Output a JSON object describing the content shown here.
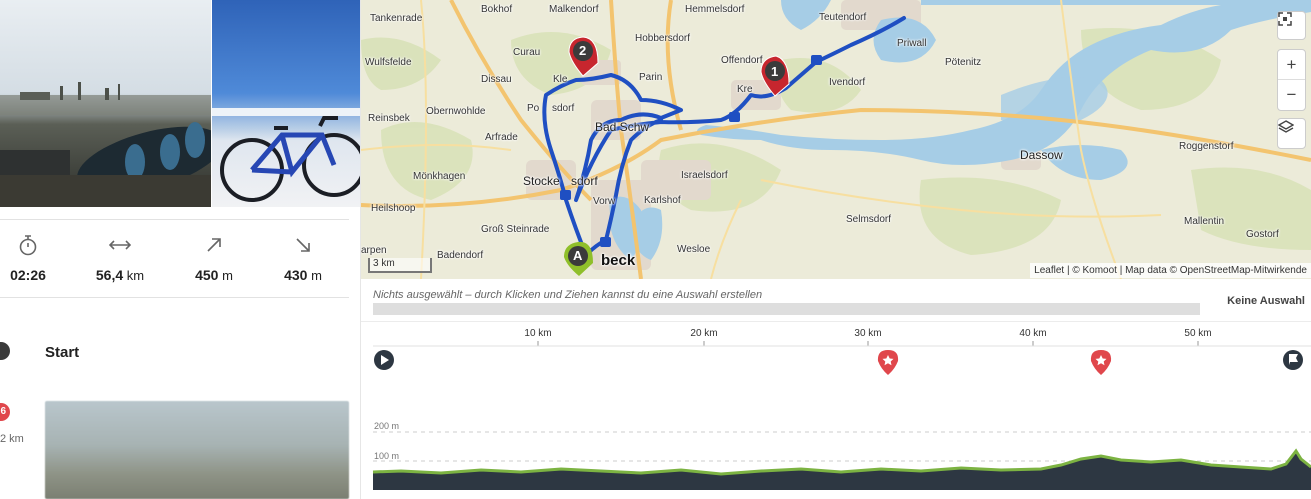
{
  "stats": {
    "duration": {
      "icon": "stopwatch-icon",
      "value": "02:26",
      "unit": ""
    },
    "distance": {
      "icon": "distance-arrows-icon",
      "value": "56,4",
      "unit": " km"
    },
    "uphill": {
      "icon": "arrow-up-right-icon",
      "value": "450",
      "unit": " m"
    },
    "downhill": {
      "icon": "arrow-down-right-icon",
      "value": "430",
      "unit": " m"
    }
  },
  "timeline": {
    "start_label": "Start",
    "highlight_badge": "6",
    "highlight_distance": "2 km"
  },
  "map": {
    "places": [
      {
        "name": "Tankenrade"
      },
      {
        "name": "Bokhof"
      },
      {
        "name": "Malkendorf"
      },
      {
        "name": "Hemmelsdorf"
      },
      {
        "name": "Teutendorf"
      },
      {
        "name": "Priwall"
      },
      {
        "name": "Curau"
      },
      {
        "name": "Hobbersdorf"
      },
      {
        "name": "Wulfsfelde"
      },
      {
        "name": "Dissau"
      },
      {
        "name": "Kle"
      },
      {
        "name": "Parin"
      },
      {
        "name": "Offendorf"
      },
      {
        "name": "Ivendorf"
      },
      {
        "name": "Pötenitz"
      },
      {
        "name": "Obernwohlde"
      },
      {
        "name": "Po"
      },
      {
        "name": "sdorf"
      },
      {
        "name": "Kre"
      },
      {
        "name": "Reinsbek"
      },
      {
        "name": "Arfrade"
      },
      {
        "name": "Bad Schw"
      },
      {
        "name": "Dassow"
      },
      {
        "name": "Roggenstorf"
      },
      {
        "name": "Mönkhagen"
      },
      {
        "name": "Stocke"
      },
      {
        "name": "sdorf"
      },
      {
        "name": "Israelsdorf"
      },
      {
        "name": "Heilshoop"
      },
      {
        "name": "Vorw"
      },
      {
        "name": "Karlshof"
      },
      {
        "name": "Selmsdorf"
      },
      {
        "name": "Mallentin"
      },
      {
        "name": "Groß Steinrade"
      },
      {
        "name": "Gostorf"
      },
      {
        "name": "arpen"
      },
      {
        "name": "Wesloe"
      },
      {
        "name": "Badendorf"
      },
      {
        "name": "beck"
      }
    ],
    "markers": {
      "waypoint1": "1",
      "waypoint2": "2",
      "start": "A"
    },
    "scale_label": "3 km",
    "attribution": "Leaflet | © Komoot | Map data © OpenStreetMap-Mitwirkende",
    "controls": {
      "fullscreen_icon": "fullscreen-icon",
      "zoom_in": "+",
      "zoom_out": "−",
      "layers_icon": "layers-icon"
    },
    "colors": {
      "route": "#1f4fc2",
      "marker_red": "#c7262e",
      "marker_green": "#8fbf2a",
      "water": "#a6cde6",
      "road": "#f3c46f"
    }
  },
  "elevation": {
    "selection_hint": "Nichts ausgewählt – durch Klicken und Ziehen kannst du eine Auswahl erstellen",
    "selection_label": "Keine Auswahl",
    "km_ticks": [
      "10 km",
      "20 km",
      "30 km",
      "40 km",
      "50 km"
    ],
    "alt_labels": [
      "200 m",
      "100 m"
    ],
    "waypoint_icons": [
      "play-icon",
      "star-icon",
      "star-icon",
      "finish-flag-icon"
    ],
    "profile_color": "#7cb342",
    "profile_fill": "#2d3742"
  }
}
